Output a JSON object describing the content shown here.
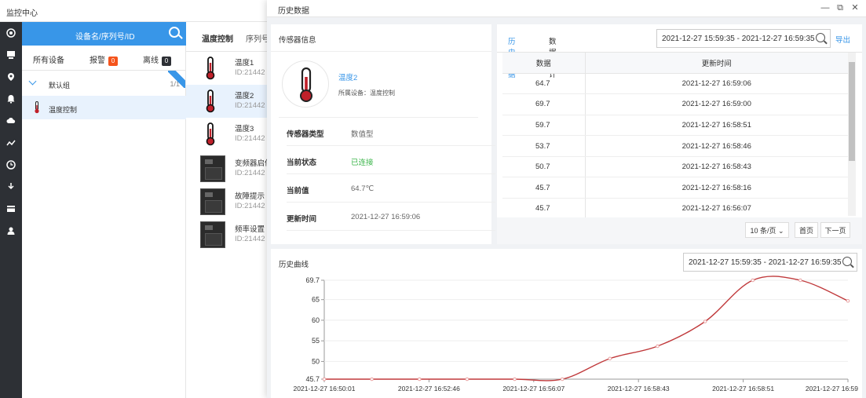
{
  "app": {
    "title": "监控中心"
  },
  "rail": {
    "icons": [
      "target-icon",
      "device-icon",
      "location-icon",
      "alarm-icon",
      "cloud-icon",
      "chart-icon",
      "clock-icon",
      "download-icon",
      "card-icon",
      "user-icon"
    ]
  },
  "device_panel": {
    "search_placeholder": "设备名/序列号/ID",
    "tabs": [
      {
        "label": "所有设备"
      },
      {
        "label": "报警",
        "badge": "0"
      },
      {
        "label": "离线",
        "badge": "0"
      }
    ],
    "group": {
      "name": "默认组",
      "count": "1/1"
    },
    "device": {
      "name": "温度控制"
    }
  },
  "sensor_list": {
    "header": "温度控制",
    "header_col": "序列号",
    "items": [
      {
        "name": "温度1",
        "id": "ID:21442",
        "kind": "thermo"
      },
      {
        "name": "温度2",
        "id": "ID:21442",
        "kind": "thermo",
        "selected": true
      },
      {
        "name": "温度3",
        "id": "ID:21442",
        "kind": "thermo"
      },
      {
        "name": "变频器启停",
        "id": "ID:21442",
        "kind": "vfd"
      },
      {
        "name": "故障提示",
        "id": "ID:21442",
        "kind": "vfd"
      },
      {
        "name": "频率设置",
        "id": "ID:21442",
        "kind": "vfd"
      }
    ]
  },
  "modal": {
    "title": "历史数据",
    "sensor_info": {
      "title": "传感器信息",
      "name": "温度2",
      "device_line": "所属设备：温度控制",
      "rows": [
        {
          "key": "传感器类型",
          "value": "数值型"
        },
        {
          "key": "当前状态",
          "value": "已连接"
        },
        {
          "key": "当前值",
          "value": "64.7℃"
        },
        {
          "key": "更新时间",
          "value": "2021-12-27 16:59:06"
        }
      ]
    },
    "history": {
      "tabs": [
        "历史数据",
        "数据统计"
      ],
      "range": "2021-12-27 15:59:35 - 2021-12-27 16:59:35",
      "export_label": "导出",
      "columns": [
        "数据",
        "更新时间"
      ],
      "rows": [
        [
          "64.7",
          "2021-12-27 16:59:06"
        ],
        [
          "69.7",
          "2021-12-27 16:59:00"
        ],
        [
          "59.7",
          "2021-12-27 16:58:51"
        ],
        [
          "53.7",
          "2021-12-27 16:58:46"
        ],
        [
          "50.7",
          "2021-12-27 16:58:43"
        ],
        [
          "45.7",
          "2021-12-27 16:58:16"
        ],
        [
          "45.7",
          "2021-12-27 16:56:07"
        ]
      ],
      "page_size": "10 条/页",
      "first_page": "首页",
      "next_page": "下一页"
    },
    "curve": {
      "title": "历史曲线",
      "range": "2021-12-27 15:59:35 - 2021-12-27 16:59:35"
    }
  },
  "chart_data": {
    "type": "line",
    "title": "",
    "xlabel": "",
    "ylabel": "",
    "x_ticks": [
      "2021-12-27 16:50:01",
      "2021-12-27 16:52:46",
      "2021-12-27 16:56:07",
      "2021-12-27 16:58:43",
      "2021-12-27 16:58:51",
      "2021-12-27 16:59"
    ],
    "y_ticks": [
      "45.7",
      "50",
      "55",
      "60",
      "65",
      "69.7"
    ],
    "ylim": [
      45.7,
      69.7
    ],
    "series": [
      {
        "color": "#c0393b",
        "x": [
          "16:50:01",
          "16:51:23",
          "16:52:46",
          "16:54:26",
          "16:56:07",
          "16:57:25",
          "16:58:43",
          "16:58:47",
          "16:58:51",
          "16:58:58",
          "16:59:00",
          "16:59:06"
        ],
        "values": [
          45.7,
          45.7,
          45.7,
          45.7,
          45.7,
          45.7,
          50.7,
          53.7,
          59.7,
          69.7,
          69.7,
          64.7
        ]
      }
    ]
  }
}
